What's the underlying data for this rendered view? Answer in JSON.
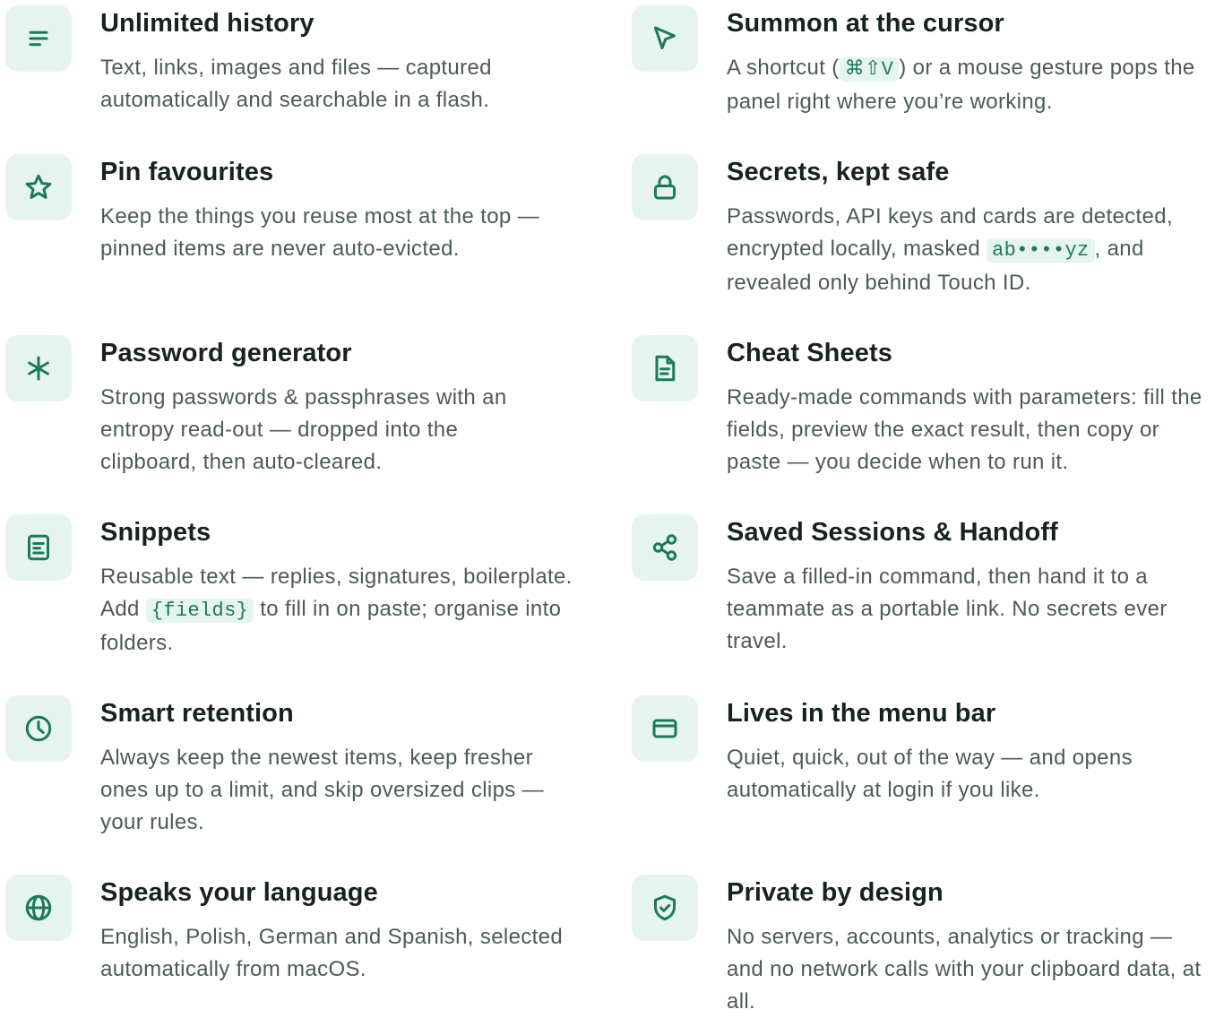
{
  "accent": "#1b7a5a",
  "tile_bg": "#e6f4ef",
  "features": [
    {
      "title": "Unlimited history",
      "icon": "list-icon",
      "desc": [
        "Text, links, images and files — captured automatically and searchable in a flash."
      ]
    },
    {
      "title": "Summon at the cursor",
      "icon": "cursor-icon",
      "desc": [
        "A shortcut (",
        "⌘⇧V",
        ") or a mouse gesture pops the panel right where you’re working."
      ]
    },
    {
      "title": "Pin favourites",
      "icon": "star-icon",
      "desc": [
        "Keep the things you reuse most at the top — pinned items are never auto-evicted."
      ]
    },
    {
      "title": "Secrets, kept safe",
      "icon": "lock-icon",
      "desc": [
        "Passwords, API keys and cards are detected, encrypted locally, masked ",
        "ab••••yz",
        ", and revealed only behind Touch ID."
      ]
    },
    {
      "title": "Password generator",
      "icon": "asterisk-icon",
      "desc": [
        "Strong passwords & passphrases with an entropy read-out — dropped into the clipboard, then auto-cleared."
      ]
    },
    {
      "title": "Cheat Sheets",
      "icon": "document-icon",
      "desc": [
        "Ready-made commands with parameters: fill the fields, preview the exact result, then copy or paste — you decide when to run it."
      ]
    },
    {
      "title": "Snippets",
      "icon": "snippet-icon",
      "desc": [
        "Reusable text — replies, signatures, boilerplate. Add ",
        "{fields}",
        " to fill in on paste; organise into folders."
      ]
    },
    {
      "title": "Saved Sessions & Handoff",
      "icon": "share-icon",
      "desc": [
        "Save a filled-in command, then hand it to a teammate as a portable link. No secrets ever travel."
      ]
    },
    {
      "title": "Smart retention",
      "icon": "clock-icon",
      "desc": [
        "Always keep the newest items, keep fresher ones up to a limit, and skip oversized clips — your rules."
      ]
    },
    {
      "title": "Lives in the menu bar",
      "icon": "window-icon",
      "desc": [
        "Quiet, quick, out of the way — and opens automatically at login if you like."
      ]
    },
    {
      "title": "Speaks your language",
      "icon": "globe-icon",
      "desc": [
        "English, Polish, German and Spanish, selected automatically from macOS."
      ]
    },
    {
      "title": "Private by design",
      "icon": "shield-check-icon",
      "desc": [
        "No servers, accounts, analytics or tracking — and no network calls with your clipboard data, at all."
      ]
    }
  ]
}
